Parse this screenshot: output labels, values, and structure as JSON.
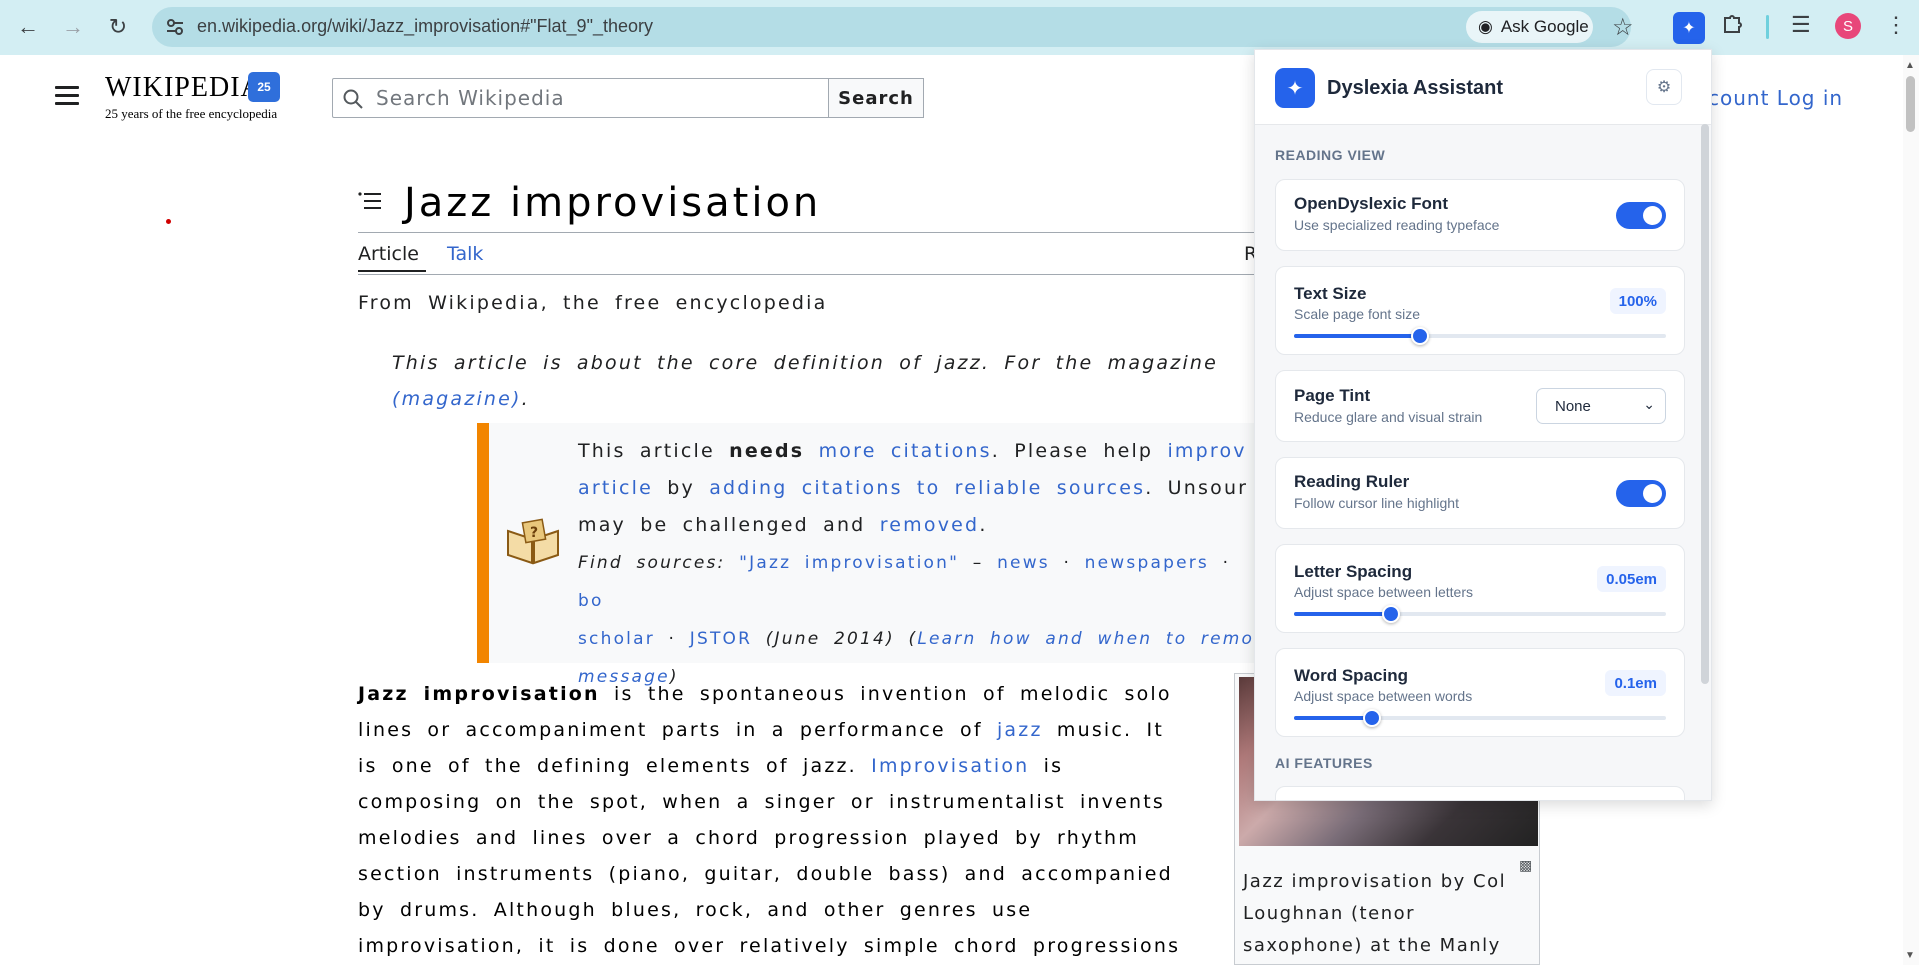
{
  "browser": {
    "url": "en.wikipedia.org/wiki/Jazz_improvisation#\"Flat_9\"_theory",
    "ask_google": "Ask Google",
    "avatar_letter": "S"
  },
  "wiki": {
    "logo_title": "WIKIPEDIA",
    "logo_badge": "25",
    "tagline": "25 years of the free encyclopedia",
    "search_placeholder": "Search Wikipedia",
    "search_button": "Search",
    "account_links": "count Log in",
    "title": "Jazz improvisation",
    "tabs": {
      "article": "Article",
      "talk": "Talk",
      "read": "R"
    },
    "from_wikipedia": "From Wikipedia, the free encyclopedia",
    "hatnote": {
      "text": "This article is about the core definition of jazz. For the magazine",
      "link": "(magazine)",
      "end": "."
    },
    "ambox": {
      "t1": "This article ",
      "needs": "needs",
      "more_citations": "more citations",
      "t2": ". Please help ",
      "improve": "improv",
      "article_link": "article",
      "t3": " by ",
      "adding": "adding citations to reliable sources",
      "t4": ". Unsour",
      "t5": "may be challenged and ",
      "removed": "removed",
      "t6": ".",
      "find_sources": "Find sources: ",
      "q": "\"Jazz improvisation\"",
      "dash": " – ",
      "news": "news",
      "dot1": " · ",
      "newspapers": "newspapers",
      "dot2": " · ",
      "bo": "bo",
      "scholar": "scholar",
      "dot3": " · ",
      "jstor": "JSTOR",
      "date": " (June 2014) (",
      "learn": "Learn how and when to remo",
      "message": "message",
      "close": ")"
    },
    "lead": {
      "bold": "Jazz improvisation",
      "p1": " is the spontaneous invention of melodic solo lines or accompaniment parts in a performance of ",
      "jazz": "jazz",
      "p2": " music. It is one of the defining elements of jazz. ",
      "improvisation": "Improvisation",
      "p3": " is composing on the spot, when a singer or instrumentalist invents melodies and lines over a chord progression played by rhythm section instruments (piano, guitar, double bass) and accompanied by drums. Although blues, rock, and other genres use improvisation, it is done over relatively simple chord progressions"
    },
    "figure_caption": "Jazz improvisation by Col Loughnan (tenor saxophone) at the Manly"
  },
  "panel": {
    "title": "Dyslexia Assistant",
    "reading_view": "READING VIEW",
    "ai_features": "AI FEATURES",
    "font": {
      "title": "OpenDyslexic Font",
      "sub": "Use specialized reading typeface",
      "on": true
    },
    "text_size": {
      "title": "Text Size",
      "sub": "Scale page font size",
      "value": "100%",
      "level": 0.34
    },
    "tint": {
      "title": "Page Tint",
      "sub": "Reduce glare and visual strain",
      "selected": "None"
    },
    "ruler": {
      "title": "Reading Ruler",
      "sub": "Follow cursor line highlight",
      "on": true
    },
    "letter_spacing": {
      "title": "Letter Spacing",
      "sub": "Adjust space between letters",
      "value": "0.05em",
      "level": 0.26
    },
    "word_spacing": {
      "title": "Word Spacing",
      "sub": "Adjust space between words",
      "value": "0.1em",
      "level": 0.21
    }
  },
  "colors": {
    "accent": "#2563eb",
    "link": "#3366cc",
    "ambox_border": "#f28500",
    "browser_bar": "#d3eef3"
  }
}
